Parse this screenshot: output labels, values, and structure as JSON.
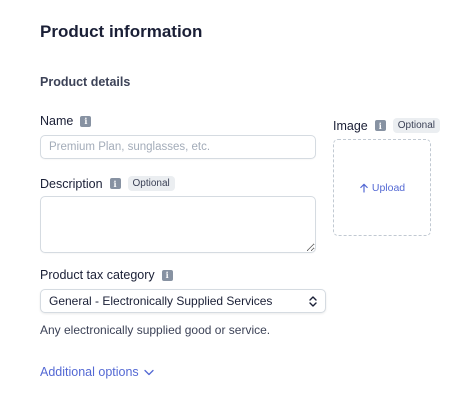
{
  "page": {
    "title": "Product information"
  },
  "section": {
    "title": "Product details"
  },
  "name_field": {
    "label": "Name",
    "placeholder": "Premium Plan, sunglasses, etc.",
    "value": ""
  },
  "description_field": {
    "label": "Description",
    "badge": "Optional",
    "value": ""
  },
  "tax_field": {
    "label": "Product tax category",
    "selected": "General - Electronically Supplied Services",
    "help": "Any electronically supplied good or service."
  },
  "additional_options": {
    "label": "Additional options"
  },
  "image_field": {
    "label": "Image",
    "badge": "Optional",
    "upload_label": "Upload"
  },
  "icons": {
    "info": "info-icon",
    "updown": "chevron-updown-icon",
    "down": "chevron-down-icon",
    "upload": "arrow-up-icon"
  },
  "colors": {
    "accent": "#5469d4",
    "text": "#1a1f36",
    "muted": "#3c4257",
    "border": "#d5dbe1",
    "badge_bg": "#ebeef1"
  }
}
